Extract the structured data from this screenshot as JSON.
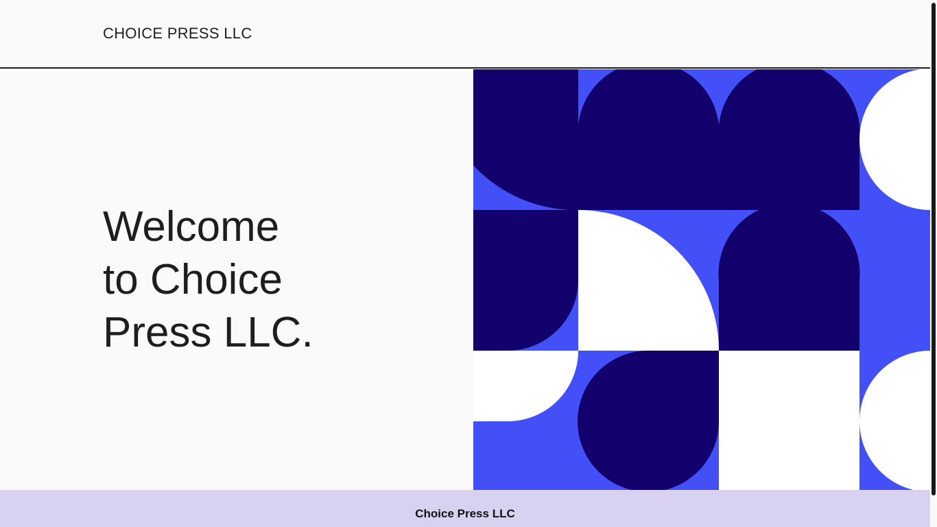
{
  "header": {
    "site_title": "CHOICE PRESS LLC"
  },
  "hero": {
    "heading_line1": "Welcome",
    "heading_line2": "to Choice",
    "heading_line3": "Press LLC.",
    "art_colors": {
      "blue": "#4350f7",
      "navy": "#12006c",
      "white": "#ffffff"
    }
  },
  "footer": {
    "text": "Choice Press LLC",
    "background": "#d8d1ef"
  }
}
